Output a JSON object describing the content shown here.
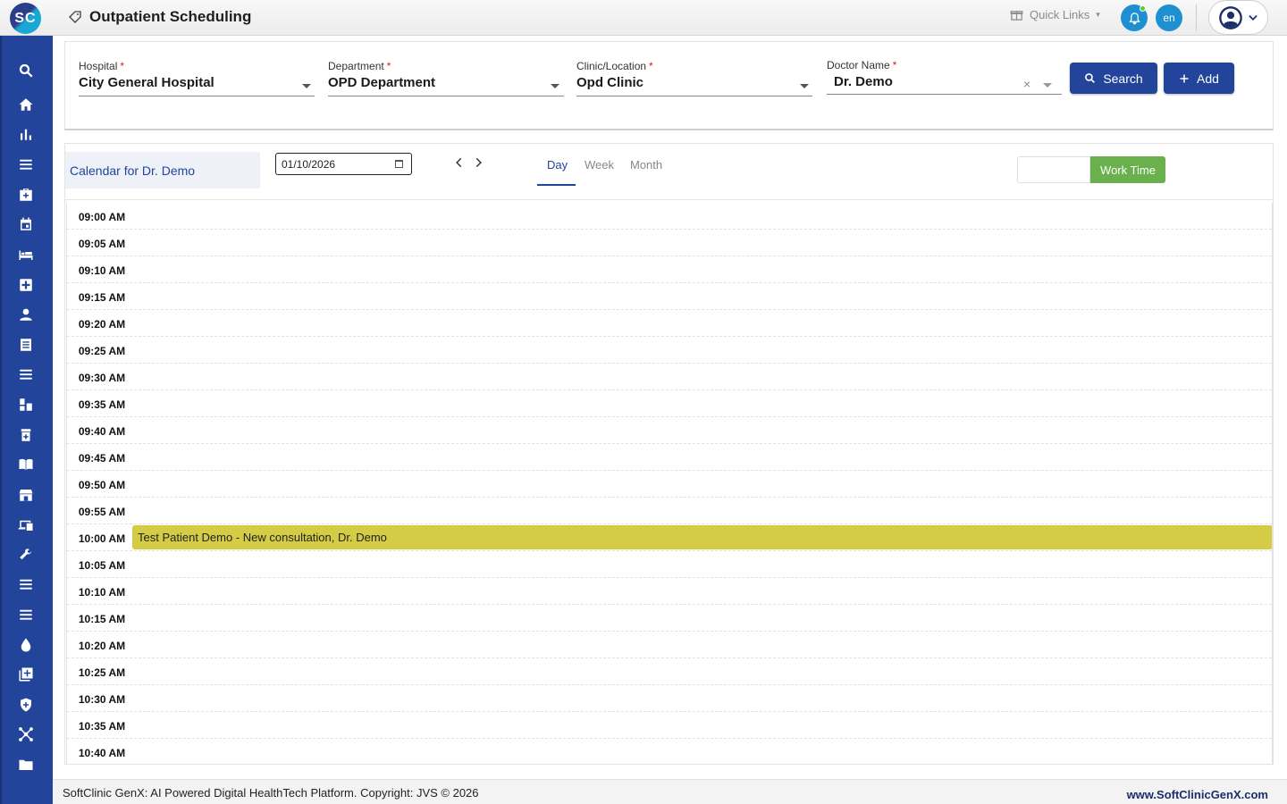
{
  "app": {
    "logo_text": "SC",
    "title": "Outpatient Scheduling"
  },
  "topbar": {
    "quick_links": "Quick Links",
    "language": "en"
  },
  "sidebar": {
    "icons": [
      "search-icon",
      "home-icon",
      "bar-chart-icon",
      "menu-icon",
      "medical-bag-icon",
      "calendar-icon",
      "bed-icon",
      "medical-cross-icon",
      "person-icon",
      "document-icon",
      "menu-icon",
      "pharmacy-icon",
      "medicine-icon",
      "book-icon",
      "store-icon",
      "devices-icon",
      "wrench-icon",
      "menu-icon",
      "menu-icon",
      "drop-icon",
      "add-box-icon",
      "shield-icon",
      "network-icon",
      "folder-icon"
    ]
  },
  "filters": {
    "hospital": {
      "label": "Hospital",
      "required": "*",
      "value": "City General Hospital"
    },
    "department": {
      "label": "Department",
      "required": "*",
      "value": "OPD Department"
    },
    "clinic": {
      "label": "Clinic/Location",
      "required": "*",
      "value": "Opd Clinic"
    },
    "doctor": {
      "label": "Doctor Name",
      "required": "*",
      "value": "Dr. Demo",
      "clear": "×"
    },
    "search_label": "Search",
    "add_label": "Add"
  },
  "calendar": {
    "title": "Calendar for Dr. Demo",
    "date": "01/10/2026",
    "views": [
      "Day",
      "Week",
      "Month"
    ],
    "active_view": "Day",
    "work_time_label": "Work Time",
    "slots": [
      "09:00 AM",
      "09:05 AM",
      "09:10 AM",
      "09:15 AM",
      "09:20 AM",
      "09:25 AM",
      "09:30 AM",
      "09:35 AM",
      "09:40 AM",
      "09:45 AM",
      "09:50 AM",
      "09:55 AM",
      "10:00 AM",
      "10:05 AM",
      "10:10 AM",
      "10:15 AM",
      "10:20 AM",
      "10:25 AM",
      "10:30 AM",
      "10:35 AM",
      "10:40 AM"
    ],
    "event": {
      "slot": "10:00 AM",
      "text": "Test Patient Demo - New consultation, Dr. Demo",
      "color": "#d4cc44"
    }
  },
  "footer": {
    "text": "SoftClinic GenX: AI Powered Digital HealthTech Platform. Copyright: JVS © 2026",
    "link": "www.SoftClinicGenX.com"
  },
  "colors": {
    "primary": "#22449b",
    "accent": "#1e8fd0",
    "work_time": "#6ab04c"
  }
}
